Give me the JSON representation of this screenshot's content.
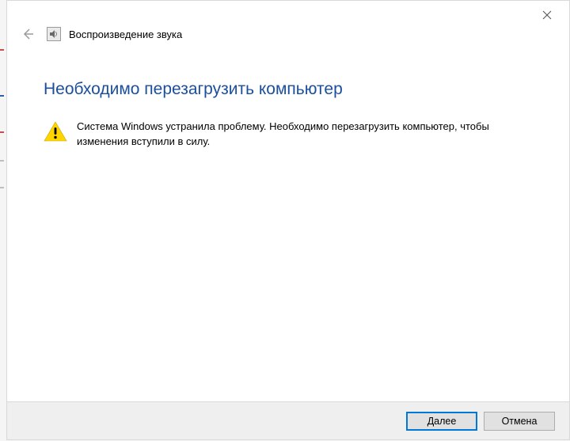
{
  "header": {
    "title": "Воспроизведение звука"
  },
  "content": {
    "heading": "Необходимо перезагрузить компьютер",
    "message": "Система Windows устранила проблему. Необходимо перезагрузить компьютер, чтобы изменения вступили в силу."
  },
  "footer": {
    "next_label": "Далее",
    "cancel_label": "Отмена"
  }
}
